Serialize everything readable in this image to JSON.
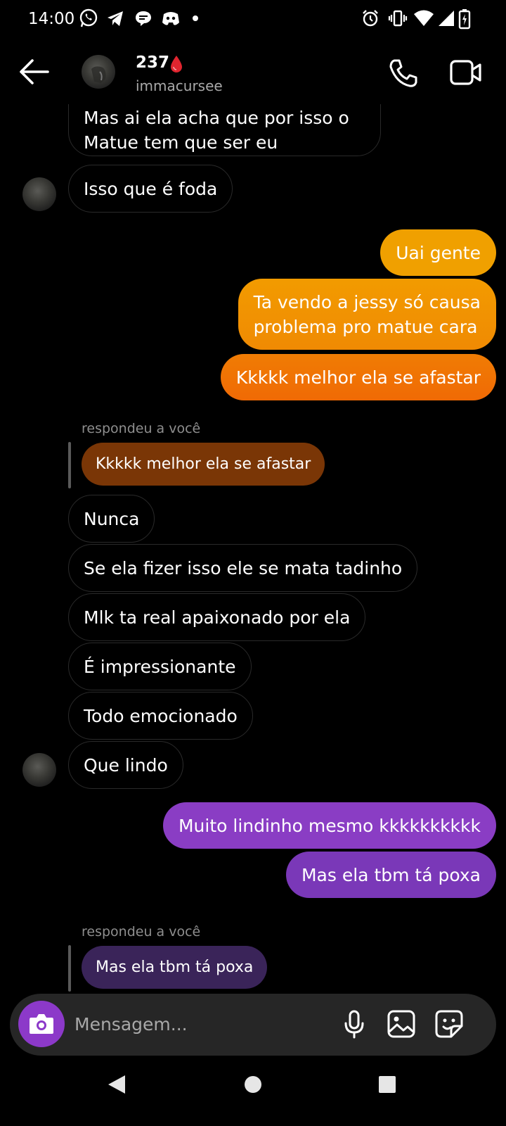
{
  "status_bar": {
    "time": "14:00"
  },
  "header": {
    "name": "237",
    "username": "immacursee"
  },
  "messages": {
    "m1": {
      "line1": "Mas ai ela acha que por isso o",
      "line2": "Matue tem que ser eu"
    },
    "m2": "Isso que é foda",
    "m3": "Uai gente",
    "m4": {
      "line1": "Ta vendo a jessy só causa",
      "line2": "problema pro matue cara"
    },
    "m5": "Kkkkk melhor ela se afastar",
    "reply1": {
      "label": "respondeu a você",
      "quoted": "Kkkkk melhor ela se afastar"
    },
    "m6": "Nunca",
    "m7": "Se ela fizer isso ele se mata tadinho",
    "m8": "Mlk ta real apaixonado por ela",
    "m9": "É impressionante",
    "m10": "Todo emocionado",
    "m11": "Que lindo",
    "m12": "Muito lindinho mesmo kkkkkkkkkk",
    "m13": "Mas ela tbm tá poxa",
    "reply2": {
      "label": "respondeu a você",
      "quoted": "Mas ela tbm tá poxa"
    }
  },
  "composer": {
    "placeholder": "Mensagem..."
  },
  "colors": {
    "orange_top": "#f0a000",
    "orange_bottom": "#f06a05",
    "purple_top": "#8a3dc4",
    "purple_bottom": "#7a38b8",
    "reply_orange": "#7a3606",
    "reply_purple": "#3a2459",
    "camera_button": "#8c39c9"
  },
  "icons": [
    "whatsapp-icon",
    "telegram-icon",
    "chat-bubble-icon",
    "discord-icon",
    "alarm-icon",
    "vibrate-icon",
    "wifi-icon",
    "signal-icon",
    "battery-icon",
    "back-arrow-icon",
    "blood-drop-icon",
    "phone-icon",
    "video-icon",
    "camera-icon",
    "microphone-icon",
    "gallery-icon",
    "sticker-icon",
    "nav-back-icon",
    "nav-home-icon",
    "nav-recents-icon"
  ]
}
